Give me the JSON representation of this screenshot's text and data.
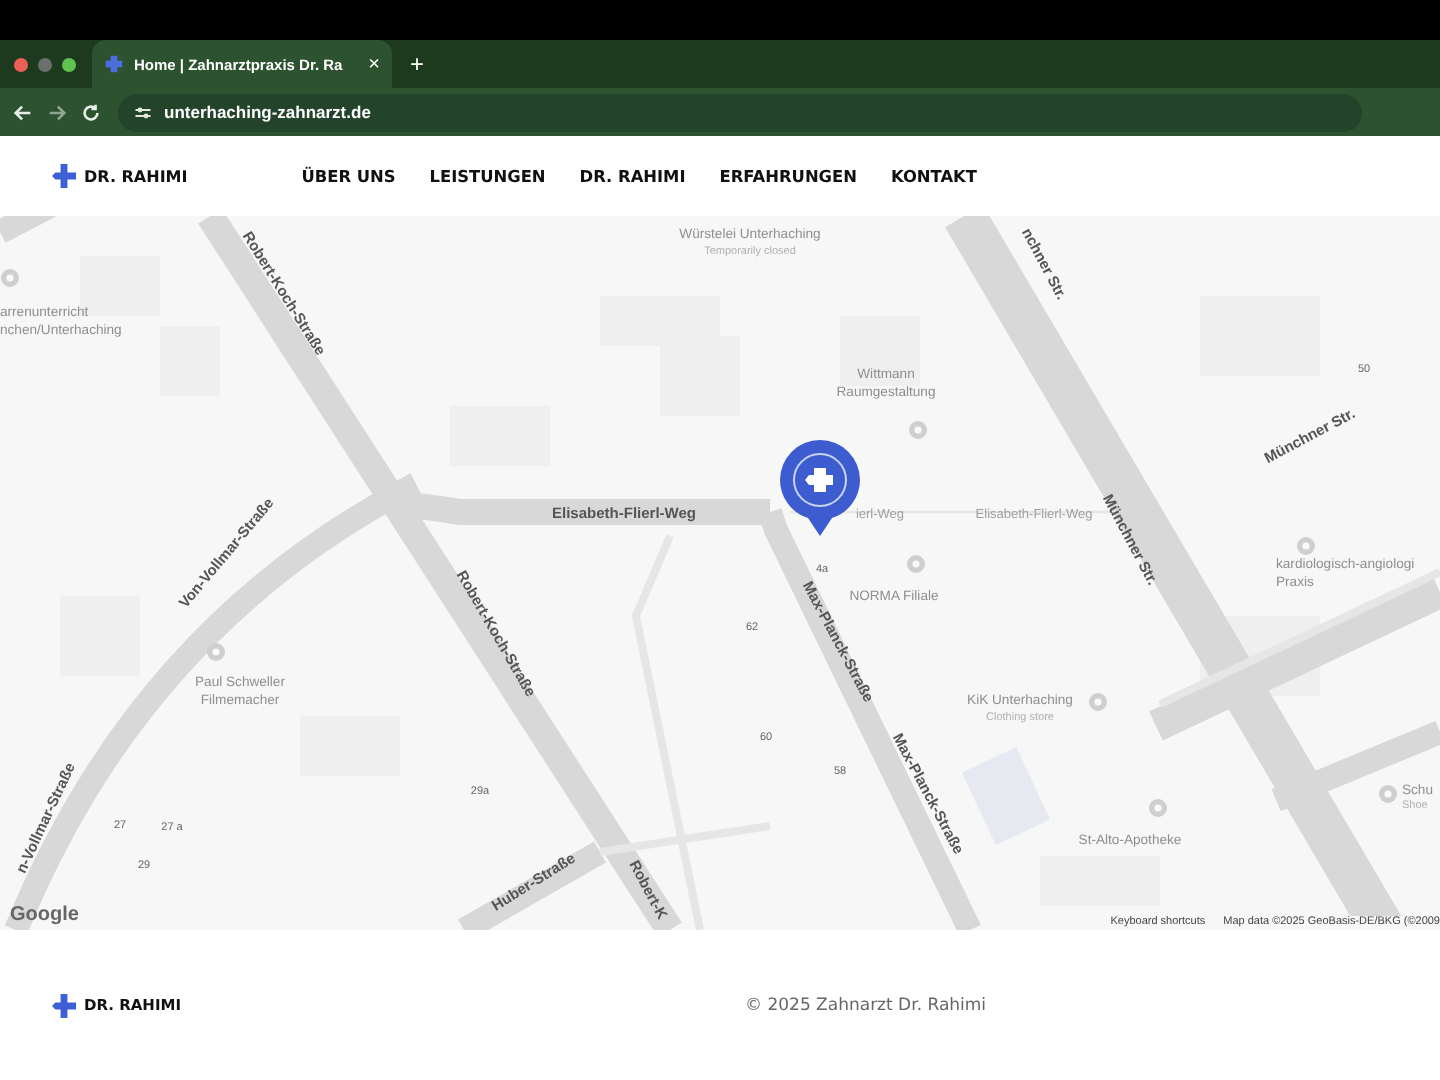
{
  "browser": {
    "tabs": [
      {
        "title": "Home | Zahnarztpraxis Dr. Ra",
        "close": "×",
        "selected": true
      }
    ],
    "new_tab": "+",
    "url": "unterhaching-zahnarzt.de"
  },
  "header": {
    "brand": "DR. RAHIMI",
    "nav": [
      {
        "label": "ÜBER UNS"
      },
      {
        "label": "LEISTUNGEN"
      },
      {
        "label": "DR. RAHIMI"
      },
      {
        "label": "ERFAHRUNGEN"
      },
      {
        "label": "KONTAKT"
      }
    ]
  },
  "map": {
    "labels": [
      {
        "text": "Würstelei Unterhaching",
        "kind": "place"
      },
      {
        "text": "Temporarily closed",
        "kind": "sub"
      },
      {
        "text": "arrenunterricht",
        "kind": "place"
      },
      {
        "text": "nchen/Unterhaching",
        "kind": "place"
      },
      {
        "text": "Robert-Koch-Straße",
        "kind": "street"
      },
      {
        "text": "Wittmann",
        "kind": "place"
      },
      {
        "text": "Raumgestaltung",
        "kind": "place"
      },
      {
        "text": "Elisabeth-Flierl-Weg",
        "kind": "street"
      },
      {
        "text": "ierl-Weg",
        "kind": "minor"
      },
      {
        "text": "Elisabeth-Flierl-Weg",
        "kind": "minor"
      },
      {
        "text": "nchner Str.",
        "kind": "street"
      },
      {
        "text": "Münchner Str.",
        "kind": "street"
      },
      {
        "text": "Münchner Str.",
        "kind": "street"
      },
      {
        "text": "50",
        "kind": "number"
      },
      {
        "text": "Von-Vollmar-Straße",
        "kind": "street"
      },
      {
        "text": "4a",
        "kind": "number"
      },
      {
        "text": "NORMA Filiale",
        "kind": "place"
      },
      {
        "text": "kardiologisch-angiologi",
        "kind": "place"
      },
      {
        "text": "Praxis",
        "kind": "place"
      },
      {
        "text": "62",
        "kind": "number"
      },
      {
        "text": "Max-Planck-Straße",
        "kind": "street"
      },
      {
        "text": "Paul Schweller",
        "kind": "place"
      },
      {
        "text": "Filmemacher",
        "kind": "place"
      },
      {
        "text": "Robert-Koch-Straße",
        "kind": "street"
      },
      {
        "text": "KiK Unterhaching",
        "kind": "place"
      },
      {
        "text": "Clothing store",
        "kind": "sub"
      },
      {
        "text": "60",
        "kind": "number"
      },
      {
        "text": "58",
        "kind": "number"
      },
      {
        "text": "Max-Planck-Straße",
        "kind": "street"
      },
      {
        "text": "Schu",
        "kind": "place"
      },
      {
        "text": "Shoe",
        "kind": "sub"
      },
      {
        "text": "29a",
        "kind": "number"
      },
      {
        "text": "n-Vollmar-Straße",
        "kind": "street"
      },
      {
        "text": "27",
        "kind": "number"
      },
      {
        "text": "27 a",
        "kind": "number"
      },
      {
        "text": "29",
        "kind": "number"
      },
      {
        "text": "St-Alto-Apotheke",
        "kind": "place"
      },
      {
        "text": "Huber-Straße",
        "kind": "street"
      },
      {
        "text": "Robert-K",
        "kind": "street"
      }
    ],
    "logo": "Google",
    "shortcuts": "Keyboard shortcuts",
    "attribution": "Map data ©2025 GeoBasis-DE/BKG (©2009"
  },
  "footer": {
    "brand": "DR. RAHIMI",
    "copyright": "© 2025 Zahnarzt Dr. Rahimi"
  }
}
